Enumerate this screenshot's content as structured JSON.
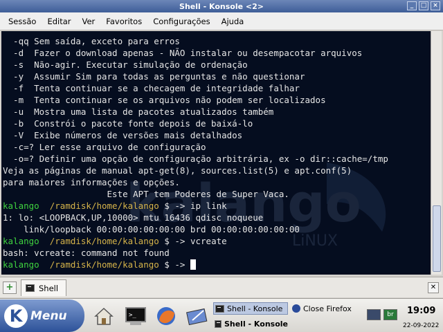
{
  "window": {
    "title": "Shell - Konsole <2>"
  },
  "menubar": {
    "items": [
      "Sessão",
      "Editar",
      "Ver",
      "Favoritos",
      "Configurações",
      "Ajuda"
    ]
  },
  "terminal": {
    "lines": [
      "  -qq Sem saída, exceto para erros",
      "  -d  Fazer o download apenas - NÃO instalar ou desempacotar arquivos",
      "  -s  Não-agir. Executar simulação de ordenação",
      "  -y  Assumir Sim para todas as perguntas e não questionar",
      "  -f  Tenta continuar se a checagem de integridade falhar",
      "  -m  Tenta continuar se os arquivos não podem ser localizados",
      "  -u  Mostra uma lista de pacotes atualizados também",
      "  -b  Constrói o pacote fonte depois de baixá-lo",
      "  -V  Exibe números de versões mais detalhados",
      "  -c=? Ler esse arquivo de configuração",
      "  -o=? Definir uma opção de configuração arbitrária, ex -o dir::cache=/tmp",
      "Veja as páginas de manual apt-get(8), sources.list(5) e apt.conf(5)",
      "para maiores informações e opções.",
      "                    Este APT tem Poderes de Super Vaca."
    ],
    "prompt_user": "kalango",
    "prompt_path": "/ramdisk/home/kalango",
    "prompt_symbol": "$ ->",
    "session": [
      {
        "type": "prompt",
        "command": "ip link"
      },
      {
        "type": "output",
        "text": "1: lo: <LOOPBACK,UP,10000> mtu 16436 qdisc noqueue"
      },
      {
        "type": "output",
        "text": "    link/loopback 00:00:00:00:00:00 brd 00:00:00:00:00:00"
      },
      {
        "type": "prompt",
        "command": "vcreate"
      },
      {
        "type": "output",
        "text": "bash: vcreate: command not found"
      },
      {
        "type": "prompt",
        "command": ""
      }
    ],
    "background_logo": {
      "text": "kalango",
      "sub": "LiNUX"
    }
  },
  "tabbar": {
    "tab_label": "Shell"
  },
  "panel": {
    "kmenu_label": "Menu",
    "tasks": [
      {
        "label": "Shell - Konsole",
        "active": true
      },
      {
        "label": "Close Firefox",
        "active": false
      },
      {
        "label": "Shell - Konsole",
        "active": false
      }
    ],
    "tray_badge": "br",
    "clock": {
      "time": "19:09",
      "date": "22-09-2022"
    }
  },
  "colors": {
    "terminal_bg": "#050d1f",
    "prompt_user": "#3fd23f",
    "prompt_path": "#d6b44a",
    "titlebar": "#4a6aa4"
  },
  "icons": [
    "home-icon",
    "terminal-icon",
    "firefox-icon",
    "kate-icon",
    "new-tab-icon",
    "close-tab-icon",
    "display-icon",
    "language-icon"
  ]
}
